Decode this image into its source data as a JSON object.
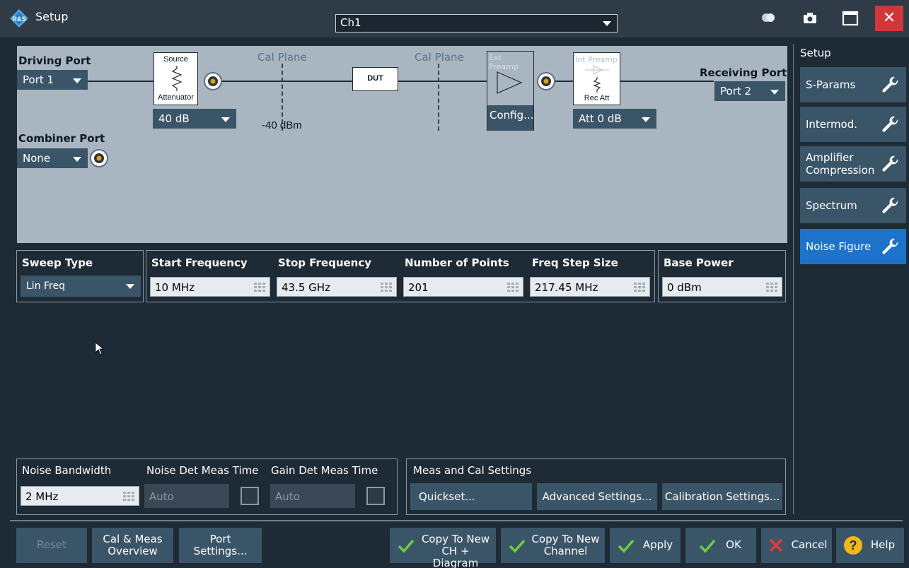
{
  "window": {
    "title": "Setup",
    "channel": "Ch1"
  },
  "diagram": {
    "driving_port_label": "Driving Port",
    "driving_port_value": "Port 1",
    "source_label": "Source",
    "attenuator_label": "Attenuator",
    "source_att_value": "40 dB",
    "cal_plane_1": "Cal Plane",
    "cal_plane_2": "Cal Plane",
    "power_level": "-40 dBm",
    "dut_label": "DUT",
    "ext_preamp_label": "Ext Preamp",
    "config_label": "Config...",
    "int_preamp_label": "Int Preamp",
    "rec_att_label": "Rec Att",
    "rec_att_value": "Att 0 dB",
    "receiving_port_label": "Receiving Port",
    "receiving_port_value": "Port 2",
    "combiner_port_label": "Combiner Port",
    "combiner_port_value": "None"
  },
  "sidebar": {
    "title": "Setup",
    "items": [
      {
        "label": "S-Params",
        "active": false
      },
      {
        "label": "Intermod.",
        "active": false
      },
      {
        "label": "Amplifier Compression",
        "line1": "Amplifier",
        "line2": "Compression",
        "active": false
      },
      {
        "label": "Spectrum",
        "active": false
      },
      {
        "label": "Noise Figure",
        "active": true
      }
    ]
  },
  "sweep": {
    "sweep_type_label": "Sweep Type",
    "sweep_type_value": "Lin Freq",
    "start_freq_label": "Start Frequency",
    "start_freq_value": "10 MHz",
    "stop_freq_label": "Stop Frequency",
    "stop_freq_value": "43.5 GHz",
    "num_points_label": "Number of Points",
    "num_points_value": "201",
    "step_size_label": "Freq Step Size",
    "step_size_value": "217.45 MHz",
    "base_power_label": "Base Power",
    "base_power_value": "0 dBm"
  },
  "noise": {
    "bandwidth_label": "Noise Bandwidth",
    "bandwidth_value": "2 MHz",
    "noise_det_label": "Noise Det Meas Time",
    "noise_det_value": "Auto",
    "gain_det_label": "Gain Det Meas Time",
    "gain_det_value": "Auto"
  },
  "meas_cal": {
    "title": "Meas and Cal Settings",
    "quickset": "Quickset...",
    "advanced": "Advanced Settings...",
    "calibration": "Calibration Settings..."
  },
  "bottom": {
    "reset": "Reset",
    "cal_meas_1": "Cal & Meas",
    "cal_meas_2": "Overview",
    "port_settings_1": "Port",
    "port_settings_2": "Settings...",
    "copy_ch_diag_1": "Copy To New",
    "copy_ch_diag_2": "CH + Diagram",
    "copy_ch_1": "Copy To New",
    "copy_ch_2": "Channel",
    "apply": "Apply",
    "ok": "OK",
    "cancel": "Cancel",
    "help": "Help"
  },
  "colors": {
    "accent": "#1d72c9",
    "button": "#3b5568",
    "close": "#d0363a",
    "check": "#6ccf3a",
    "cancel_x": "#e23a3a",
    "help": "#f1b81a"
  }
}
